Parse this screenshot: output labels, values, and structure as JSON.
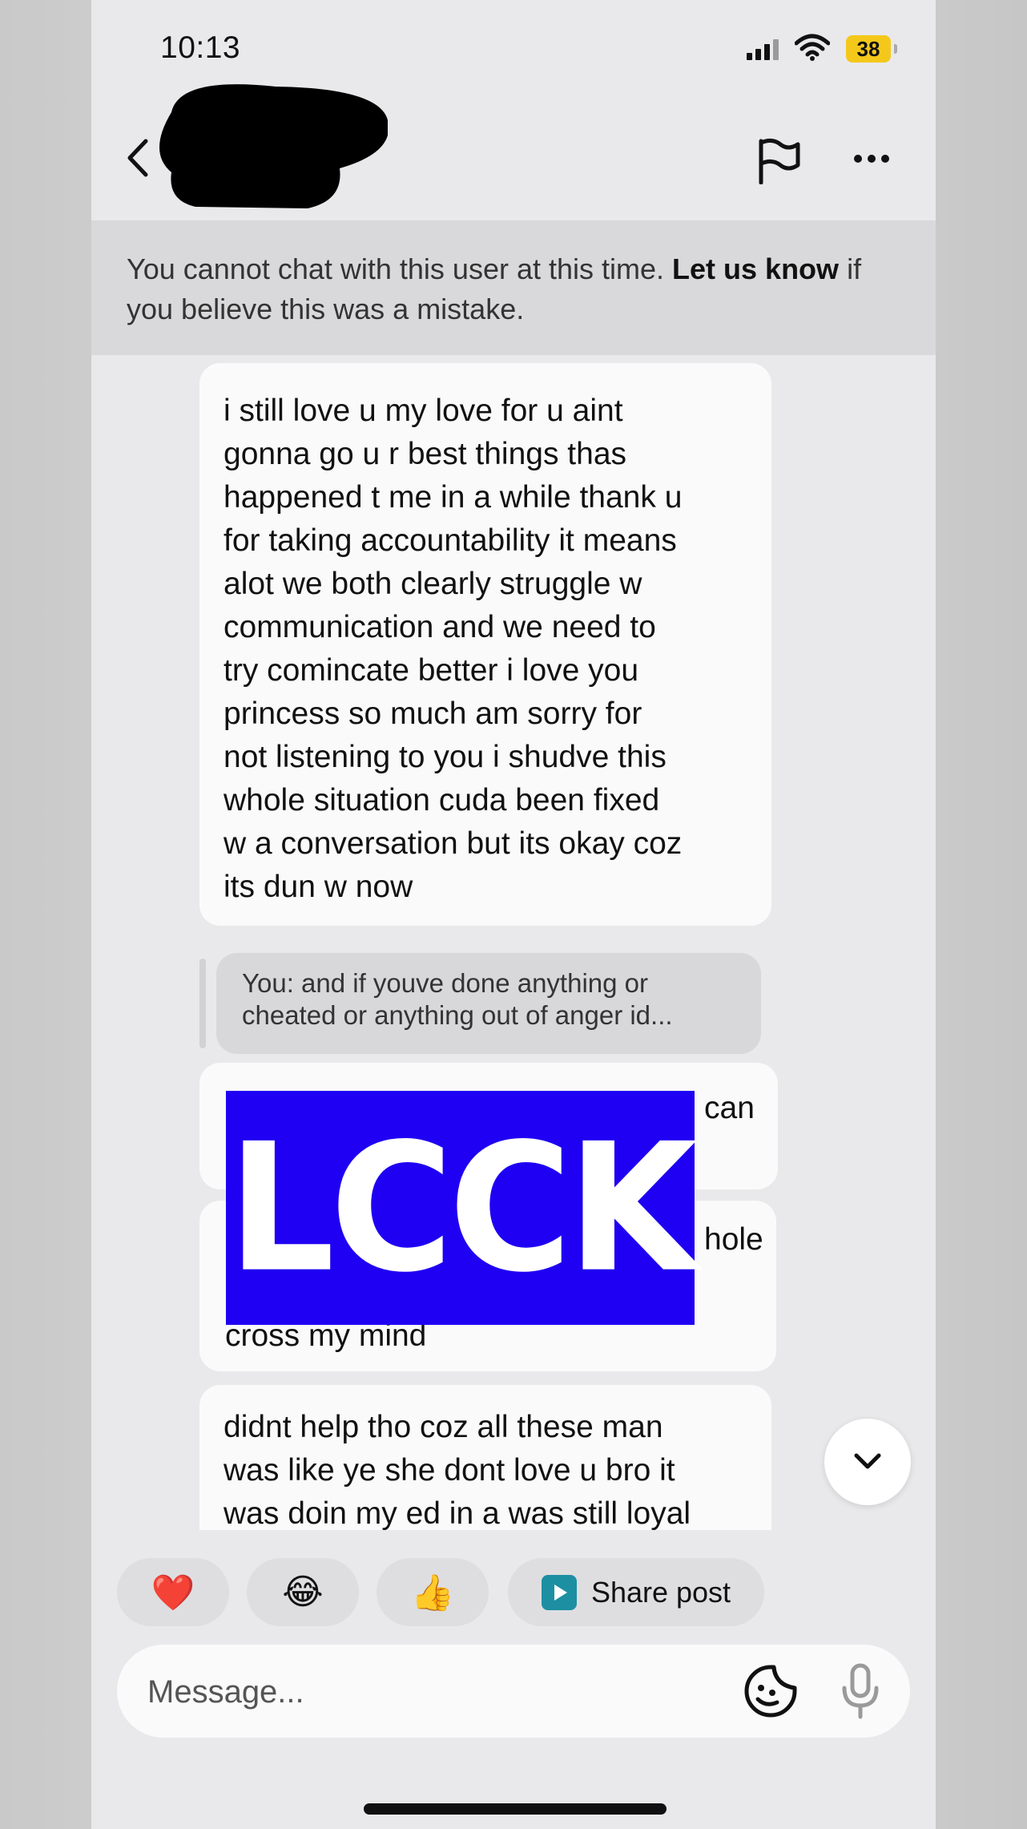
{
  "status_bar": {
    "time": "10:13",
    "battery": "38"
  },
  "header": {
    "contact_name": ""
  },
  "banner": {
    "text_before": "You cannot chat with this user at this time. ",
    "link_text": "Let us know",
    "text_after": " if you believe this was a mistake."
  },
  "messages": [
    {
      "lines": [
        "i still love u my love for u aint",
        "gonna go u r best things thas",
        "happened t me in a while thank u",
        "for taking accountability it means",
        "alot we both clearly struggle w",
        "communication and we need to",
        "try comincate better i love you",
        "princess so much am sorry for",
        "not listening to you i shudve this",
        "whole situation cuda been fixed",
        "w a conversation but its okay coz",
        "its dun w now"
      ]
    },
    {
      "quote": "You: and if youve done anything or cheated or anything out of anger id..."
    },
    {
      "fragment": "can"
    },
    {
      "fragment_1": "hole",
      "fragment_2": "cross my mind"
    },
    {
      "lines": [
        "didnt help tho coz all these man",
        "was like ye she dont love u bro it",
        "was doin my ed in a was still loyal"
      ]
    }
  ],
  "overlay_text": "LCCK",
  "quick_reactions": [
    "❤️",
    "😂",
    "👍"
  ],
  "share_post_label": "Share post",
  "composer": {
    "placeholder": "Message..."
  }
}
